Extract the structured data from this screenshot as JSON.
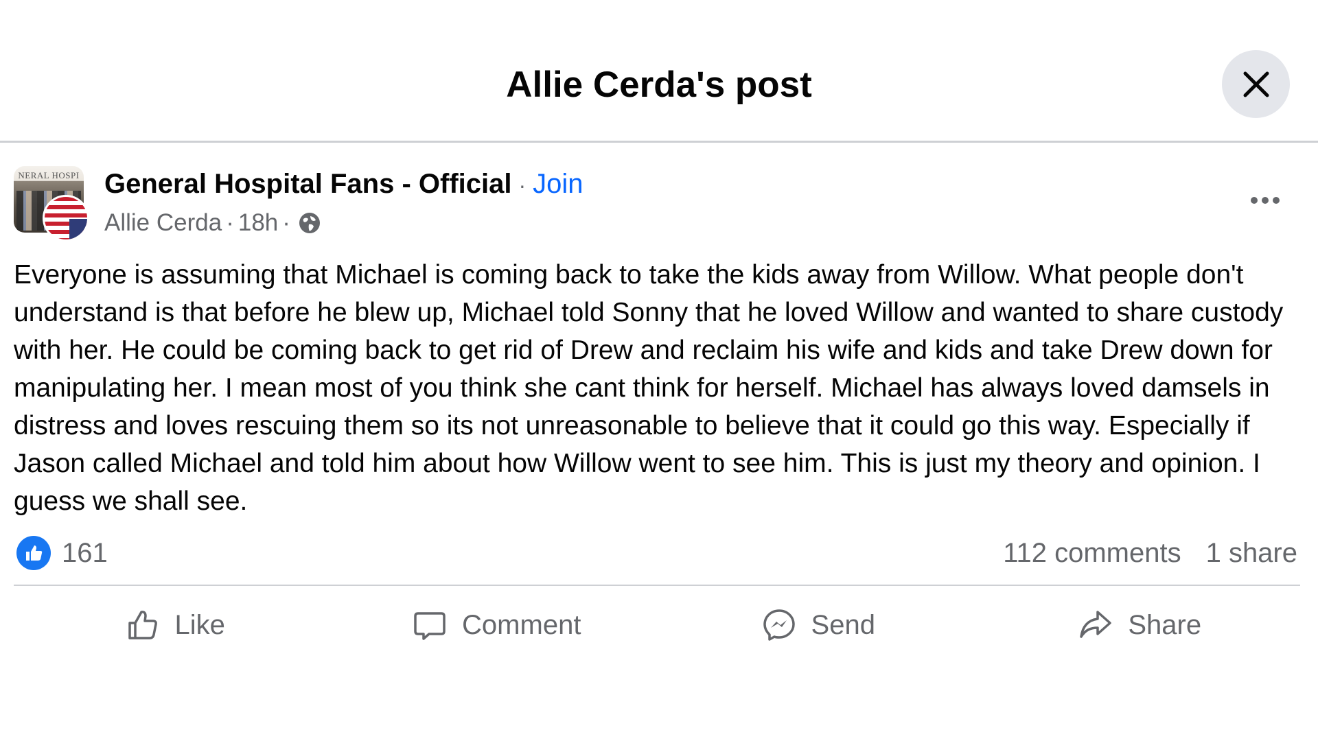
{
  "header": {
    "title": "Allie Cerda's post",
    "close_icon": "close-icon"
  },
  "post": {
    "group_name": "General Hospital Fans - Official",
    "join_separator": "·",
    "join_label": "Join",
    "avatar_banner_text": "NERAL HOSPI",
    "author": "Allie Cerda",
    "meta_separator_1": "·",
    "time": "18h",
    "meta_separator_2": "·",
    "privacy_icon": "globe-icon",
    "more_icon": "more-options-icon",
    "text": "Everyone is assuming that Michael is coming back to take the kids away from Willow. What people don't understand is that before he blew up, Michael told Sonny that he loved Willow and wanted to share custody with her. He could be coming back to get rid of Drew and reclaim his wife and kids and take Drew down for manipulating her. I mean most of you think she cant think for herself. Michael has always loved damsels in distress and loves rescuing them so its not unreasonable to believe that it could go this way. Especially if Jason called Michael and told him about how Willow went to see him. This is just my theory and opinion. I guess we shall see."
  },
  "stats": {
    "reaction_count": "161",
    "comments": "112 comments",
    "shares": "1 share"
  },
  "actions": {
    "like": "Like",
    "comment": "Comment",
    "send": "Send",
    "share": "Share"
  },
  "colors": {
    "accent": "#0866ff",
    "like_badge": "#1877f2",
    "secondary_text": "#65676b",
    "divider": "#ced0d4",
    "close_bg": "#e4e6eb"
  }
}
